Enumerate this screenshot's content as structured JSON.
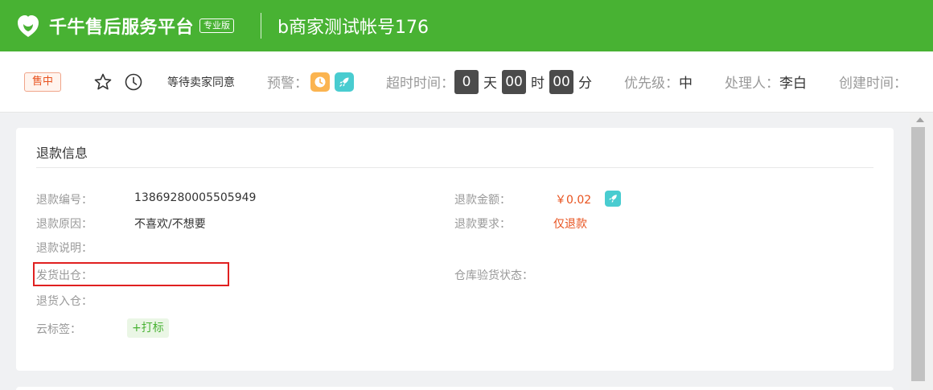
{
  "header": {
    "brand_title": "千牛售后服务平台",
    "brand_badge": "专业版",
    "account_name": "b商家测试帐号176"
  },
  "infobar": {
    "status_tag": "售中",
    "wait_status": "等待卖家同意",
    "alert_label": "预警：",
    "timeout_label": "超时时间：",
    "timeout_days": "0",
    "timeout_day_unit": "天",
    "timeout_hours": "00",
    "timeout_hour_unit": "时",
    "timeout_minutes": "00",
    "timeout_minute_unit": "分",
    "priority_label": "优先级：",
    "priority_value": "中",
    "handler_label": "处理人：",
    "handler_value": "李白",
    "created_label": "创建时间："
  },
  "refund_info": {
    "title": "退款信息",
    "refund_no_label": "退款编号：",
    "refund_no_value": "13869280005505949",
    "refund_reason_label": "退款原因：",
    "refund_reason_value": "不喜欢/不想要",
    "refund_desc_label": "退款说明：",
    "ship_out_label": "发货出仓：",
    "return_in_label": "退货入仓：",
    "cloud_tag_label": "云标签：",
    "print_tag_label": "+打标",
    "refund_amount_label": "退款金额：",
    "refund_amount_value": "￥0.02",
    "refund_request_label": "退款要求：",
    "refund_request_value": "仅退款",
    "warehouse_status_label": "仓库验货状态："
  },
  "colors": {
    "brand_green": "#48b233",
    "status_orange": "#e8521e",
    "alert_orange": "#fbb450",
    "alert_teal": "#49ccd0",
    "highlight_red": "#e02020"
  },
  "icons": {
    "logo": "qianniu-logo-icon",
    "star": "star-icon",
    "clock": "clock-icon",
    "alert_clock": "alert-clock-icon",
    "alert_rocket": "rocket-icon"
  }
}
